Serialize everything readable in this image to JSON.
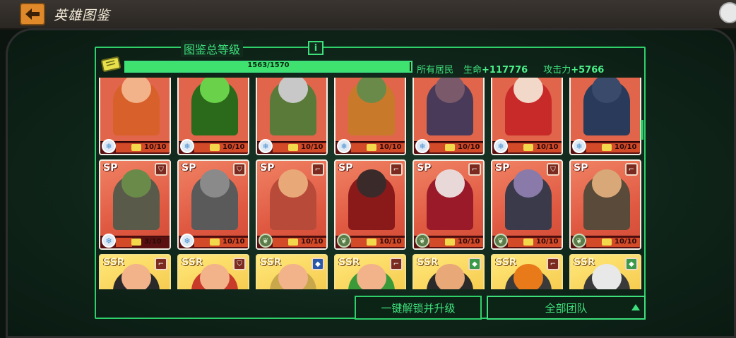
{
  "header": {
    "title": "英雄图鉴"
  },
  "panel": {
    "title": "图鉴总等级",
    "progress_text": "1563/1570",
    "progress_value": 0.9955,
    "residents_label": "所有居民",
    "life_label": "生命",
    "life_value": "+117776",
    "attack_label": "攻击力",
    "attack_value": "+5766"
  },
  "cards": [
    {
      "rarity": "",
      "type": "",
      "level": "10/10",
      "badge": "snow",
      "skin": "#f2b28a",
      "outfit": "#d8602a"
    },
    {
      "rarity": "",
      "type": "",
      "level": "10/10",
      "badge": "snow",
      "skin": "#6ad24a",
      "outfit": "#2a6a1a"
    },
    {
      "rarity": "",
      "type": "",
      "level": "10/10",
      "badge": "snow",
      "skin": "#c8c8c8",
      "outfit": "#5a7a3a"
    },
    {
      "rarity": "",
      "type": "",
      "level": "10/10",
      "badge": "snow",
      "skin": "#6a8a4a",
      "outfit": "#c87a2a"
    },
    {
      "rarity": "",
      "type": "",
      "level": "10/10",
      "badge": "snow",
      "skin": "#7a5a6a",
      "outfit": "#4a3a5a"
    },
    {
      "rarity": "",
      "type": "",
      "level": "10/10",
      "badge": "snow",
      "skin": "#f2d8c8",
      "outfit": "#c82a2a"
    },
    {
      "rarity": "",
      "type": "",
      "level": "10/10",
      "badge": "snow",
      "skin": "#3a4a6a",
      "outfit": "#2a3a5a"
    },
    {
      "rarity": "SP",
      "type": "shield",
      "level": "3/10",
      "badge": "snow",
      "skin": "#6a8a4a",
      "outfit": "#5a5a4a"
    },
    {
      "rarity": "SP",
      "type": "shield",
      "level": "10/10",
      "badge": "snow",
      "skin": "#8a8a8a",
      "outfit": "#5a5a5a"
    },
    {
      "rarity": "SP",
      "type": "gun",
      "level": "10/10",
      "badge": "leaf",
      "skin": "#e8a878",
      "outfit": "#b84a3a"
    },
    {
      "rarity": "SP",
      "type": "gun",
      "level": "10/10",
      "badge": "leaf",
      "skin": "#3a2a2a",
      "outfit": "#8a1a1a"
    },
    {
      "rarity": "SP",
      "type": "gun",
      "level": "10/10",
      "badge": "leaf",
      "skin": "#e8d8d8",
      "outfit": "#9a1a2a"
    },
    {
      "rarity": "SP",
      "type": "shield",
      "level": "10/10",
      "badge": "leaf",
      "skin": "#8a7aaa",
      "outfit": "#3a3a4a"
    },
    {
      "rarity": "SP",
      "type": "gun",
      "level": "10/10",
      "badge": "leaf",
      "skin": "#d8a878",
      "outfit": "#5a4a3a"
    },
    {
      "rarity": "SSR",
      "type": "gun",
      "level": "",
      "badge": "",
      "skin": "#f2b28a",
      "outfit": "#2a2a2a"
    },
    {
      "rarity": "SSR",
      "type": "shield",
      "level": "",
      "badge": "",
      "skin": "#f2b28a",
      "outfit": "#c83a2a"
    },
    {
      "rarity": "SSR",
      "type": "blue",
      "level": "",
      "badge": "",
      "skin": "#f2b28a",
      "outfit": "#c8a84a"
    },
    {
      "rarity": "SSR",
      "type": "gun",
      "level": "",
      "badge": "",
      "skin": "#f2b28a",
      "outfit": "#3a9a3a"
    },
    {
      "rarity": "SSR",
      "type": "green",
      "level": "",
      "badge": "",
      "skin": "#e8a878",
      "outfit": "#2a2a2a"
    },
    {
      "rarity": "SSR",
      "type": "gun",
      "level": "",
      "badge": "",
      "skin": "#e87a1a",
      "outfit": "#3a3a3a"
    },
    {
      "rarity": "SSR",
      "type": "green",
      "level": "",
      "badge": "",
      "skin": "#e8e8e8",
      "outfit": "#3a3a3a"
    }
  ],
  "buttons": {
    "unlock_all": "一键解锁并升级",
    "team_filter": "全部团队"
  }
}
